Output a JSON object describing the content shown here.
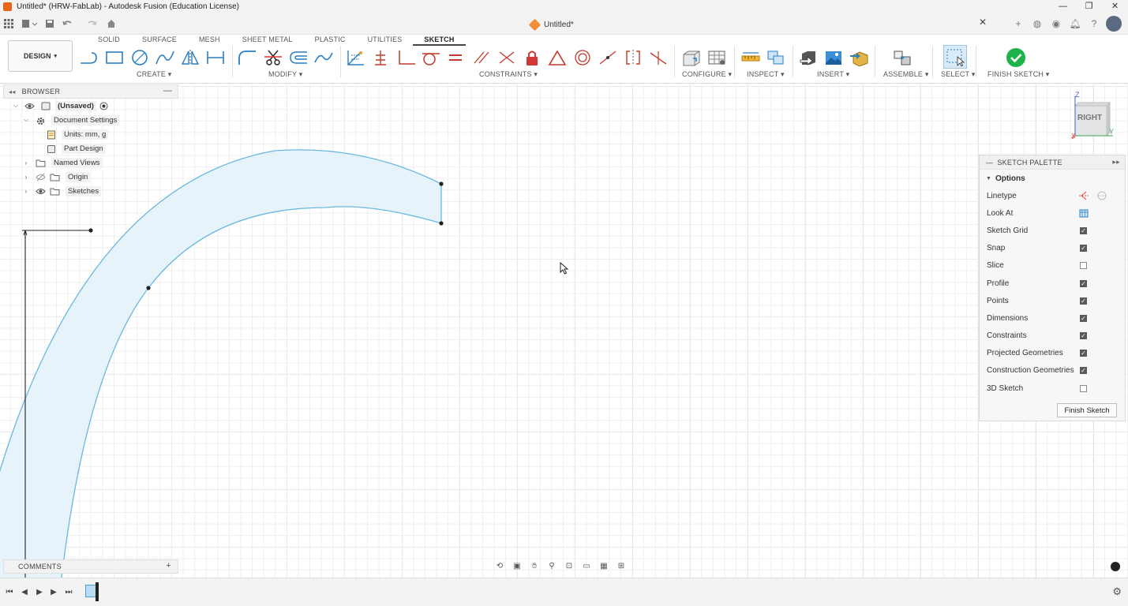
{
  "window": {
    "title": "Untitled* (HRW-FabLab) - Autodesk Fusion (Education License)",
    "minimize": "—",
    "maximize": "❐",
    "close": "✕"
  },
  "document_tab": {
    "label": "Untitled*",
    "close": "✕"
  },
  "ribbon": {
    "workspace": "DESIGN",
    "tabs": [
      "SOLID",
      "SURFACE",
      "MESH",
      "SHEET METAL",
      "PLASTIC",
      "UTILITIES",
      "SKETCH"
    ],
    "active_tab": "SKETCH",
    "groups": {
      "create": "CREATE",
      "modify": "MODIFY",
      "constraints": "CONSTRAINTS",
      "configure": "CONFIGURE",
      "inspect": "INSPECT",
      "insert": "INSERT",
      "assemble": "ASSEMBLE",
      "select": "SELECT",
      "finish": "FINISH SKETCH"
    }
  },
  "browser": {
    "header": "BROWSER",
    "items": [
      {
        "label": "(Unsaved)"
      },
      {
        "label": "Document Settings"
      },
      {
        "label": "Units: mm, g"
      },
      {
        "label": "Part Design"
      },
      {
        "label": "Named Views"
      },
      {
        "label": "Origin"
      },
      {
        "label": "Sketches"
      }
    ]
  },
  "viewcube": {
    "face": "RIGHT",
    "axis_z": "Z",
    "axis_y": "Y",
    "axis_x": "X"
  },
  "sketch_palette": {
    "header": "SKETCH PALETTE",
    "section": "Options",
    "options": [
      {
        "label": "Linetype"
      },
      {
        "label": "Look At"
      },
      {
        "label": "Sketch Grid",
        "checked": true
      },
      {
        "label": "Snap",
        "checked": true
      },
      {
        "label": "Slice",
        "checked": false
      },
      {
        "label": "Profile",
        "checked": true
      },
      {
        "label": "Points",
        "checked": true
      },
      {
        "label": "Dimensions",
        "checked": true
      },
      {
        "label": "Constraints",
        "checked": true
      },
      {
        "label": "Projected Geometries",
        "checked": true
      },
      {
        "label": "Construction Geometries",
        "checked": true
      },
      {
        "label": "3D Sketch",
        "checked": false
      }
    ],
    "finish_button": "Finish Sketch"
  },
  "comments": {
    "header": "COMMENTS"
  },
  "colors": {
    "sketch_line": "#6ab8df",
    "profile_fill": "#e6f3fb",
    "accent_green": "#1db34a",
    "app_orange": "#e8651a"
  }
}
